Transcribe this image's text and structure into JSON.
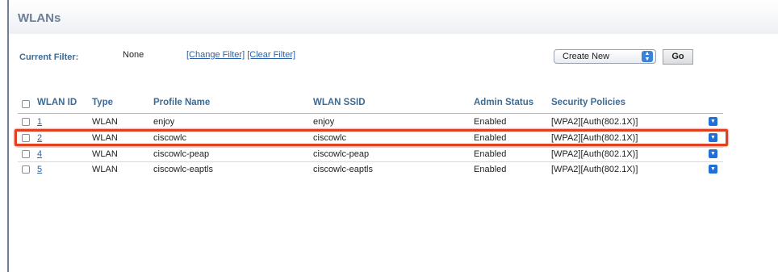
{
  "page": {
    "title": "WLANs"
  },
  "filter": {
    "label": "Current Filter:",
    "value": "None",
    "change_link": "[Change Filter]",
    "clear_link": "[Clear Filter]"
  },
  "actions": {
    "select_value": "Create New",
    "go_label": "Go"
  },
  "table": {
    "headers": {
      "wlan_id": "WLAN ID",
      "type": "Type",
      "profile": "Profile Name",
      "ssid": "WLAN SSID",
      "admin_status": "Admin Status",
      "security": "Security Policies"
    },
    "rows": [
      {
        "id": "1",
        "type": "WLAN",
        "profile": "enjoy",
        "ssid": "enjoy",
        "status": "Enabled",
        "security": "[WPA2][Auth(802.1X)]"
      },
      {
        "id": "2",
        "type": "WLAN",
        "profile": "ciscowlc",
        "ssid": "ciscowlc",
        "status": "Enabled",
        "security": "[WPA2][Auth(802.1X)]"
      },
      {
        "id": "4",
        "type": "WLAN",
        "profile": "ciscowlc-peap",
        "ssid": "ciscowlc-peap",
        "status": "Enabled",
        "security": "[WPA2][Auth(802.1X)]"
      },
      {
        "id": "5",
        "type": "WLAN",
        "profile": "ciscowlc-eaptls",
        "ssid": "ciscowlc-eaptls",
        "status": "Enabled",
        "security": "[WPA2][Auth(802.1X)]"
      }
    ]
  },
  "colors": {
    "highlight": "#e0401f",
    "header_text": "#3d6b94",
    "link": "#2a62a8",
    "icon_blue": "#1f6fd6"
  },
  "icons": {
    "row_menu": "chevron-down-icon",
    "select_arrows": "updown-arrows-icon"
  }
}
